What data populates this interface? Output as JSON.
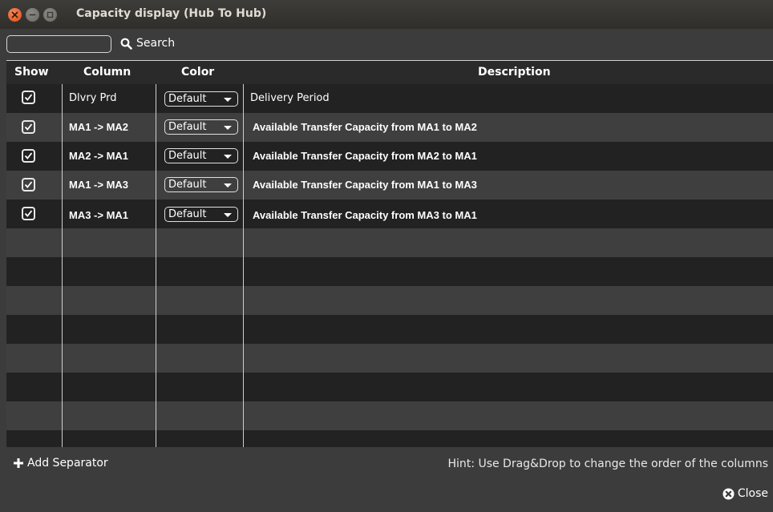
{
  "window": {
    "title": "Capacity display (Hub To Hub)"
  },
  "search": {
    "value": "",
    "button_label": "Search"
  },
  "table": {
    "headers": {
      "show": "Show",
      "column": "Column",
      "color": "Color",
      "description": "Description"
    },
    "rows": [
      {
        "show": true,
        "column": "Dlvry Prd",
        "color": "Default",
        "description": "Delivery Period"
      },
      {
        "show": true,
        "column": "MA1 -> MA2",
        "color": "Default",
        "description": "Available Transfer Capacity from MA1 to MA2"
      },
      {
        "show": true,
        "column": "MA2 -> MA1",
        "color": "Default",
        "description": "Available Transfer Capacity from MA2 to MA1"
      },
      {
        "show": true,
        "column": "MA1 -> MA3",
        "color": "Default",
        "description": "Available Transfer Capacity from MA1 to MA3"
      },
      {
        "show": true,
        "column": "MA3 -> MA1",
        "color": "Default",
        "description": "Available Transfer Capacity from MA3 to MA1"
      }
    ]
  },
  "footer": {
    "add_separator_label": "Add Separator",
    "hint": "Hint: Use Drag&Drop to change the order of the columns",
    "close_label": "Close"
  },
  "icons": {
    "window_close": "close-icon",
    "window_minimize": "minimize-icon",
    "window_maximize": "maximize-icon",
    "search": "search-icon",
    "add": "plus-icon",
    "close": "close-circle-icon",
    "checkbox": "check-icon",
    "dropdown": "chevron-down-icon"
  },
  "colors": {
    "titlebar": "#2f2e2b",
    "background": "#3c3c3c",
    "row_dark": "#222222",
    "row_light": "#3f3f3f",
    "close_button": "#de4b16"
  }
}
